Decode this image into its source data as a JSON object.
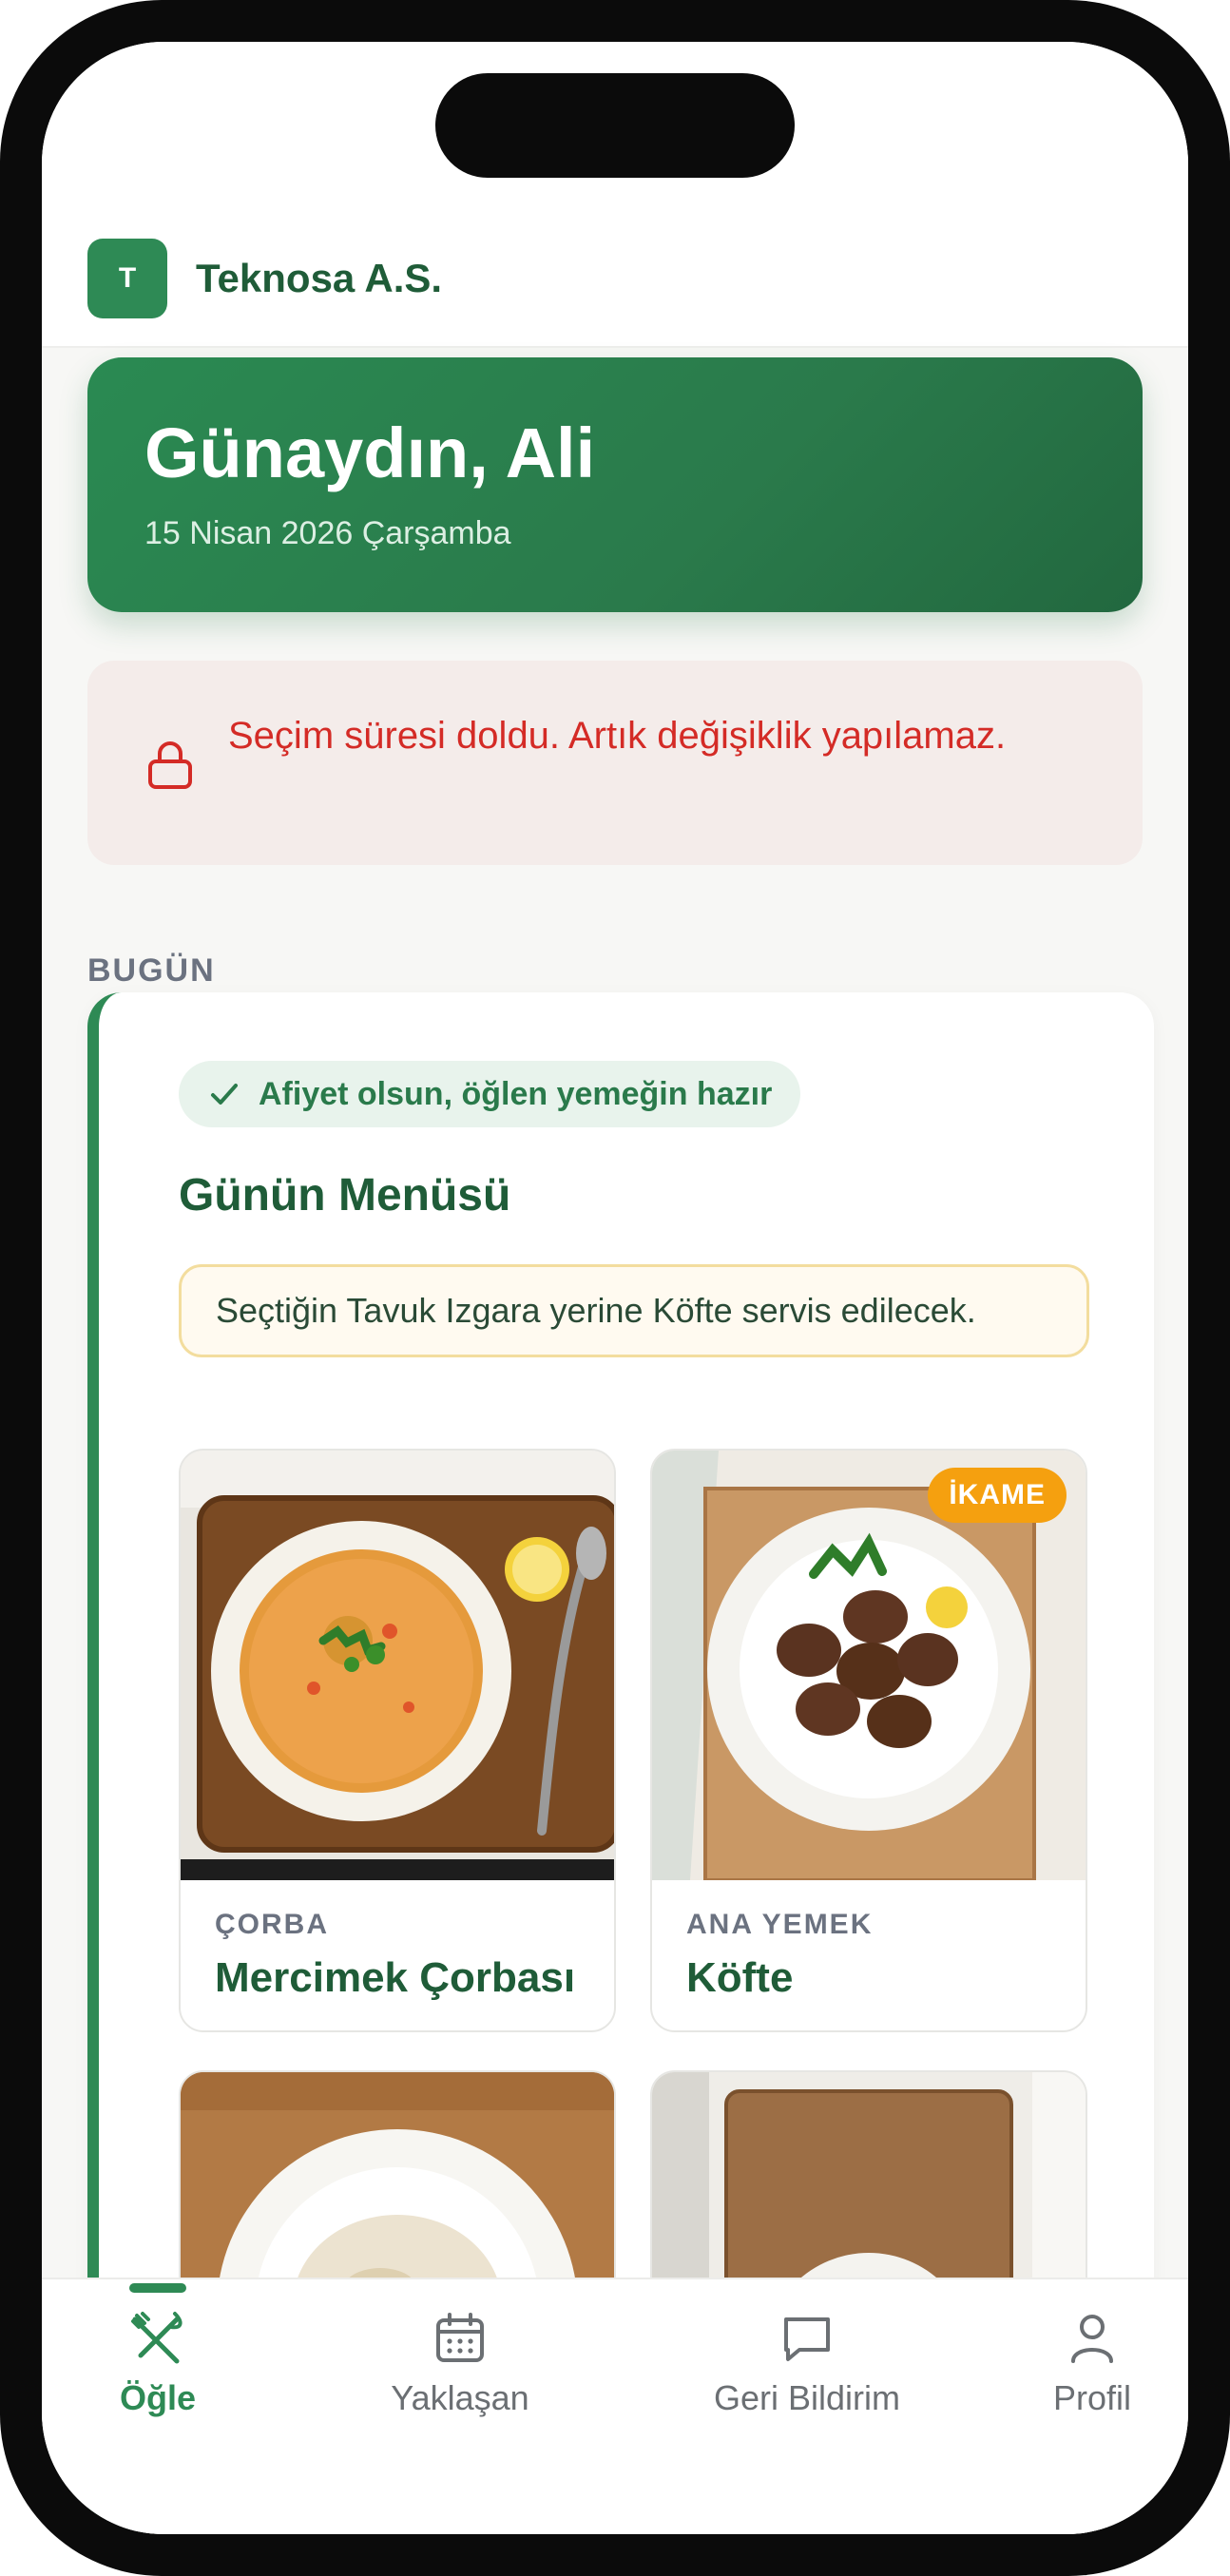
{
  "company": {
    "initial": "T",
    "name": "Teknosa A.S."
  },
  "hero": {
    "greeting": "Günaydın, Ali",
    "date": "15 Nisan 2026 Çarşamba"
  },
  "alert": {
    "icon": "lock-icon",
    "text": "Seçim süresi doldu. Artık değişiklik yapılamaz."
  },
  "section": {
    "label": "BUGÜN"
  },
  "day": {
    "status": "Afiyet olsun, öğlen yemeğin hazır",
    "menu_title": "Günün Menüsü",
    "substitution_note": "Seçtiğin Tavuk Izgara yerine Köfte servis edilecek.",
    "dishes": [
      {
        "category": "ÇORBA",
        "name": "Mercimek Çorbası",
        "badge": ""
      },
      {
        "category": "ANA YEMEK",
        "name": "Köfte",
        "badge": "İKAME"
      },
      {
        "category": "",
        "name": "",
        "badge": ""
      },
      {
        "category": "",
        "name": "",
        "badge": ""
      }
    ]
  },
  "tabs": [
    {
      "label": "Öğle",
      "icon": "utensils-icon",
      "active": true
    },
    {
      "label": "Yaklaşan",
      "icon": "calendar-icon",
      "active": false
    },
    {
      "label": "Geri Bildirim",
      "icon": "message-icon",
      "active": false
    },
    {
      "label": "Profil",
      "icon": "user-icon",
      "active": false
    }
  ],
  "colors": {
    "brand_green": "#2e8a55",
    "alert_red": "#d42b26",
    "badge_orange": "#f5a00f"
  }
}
